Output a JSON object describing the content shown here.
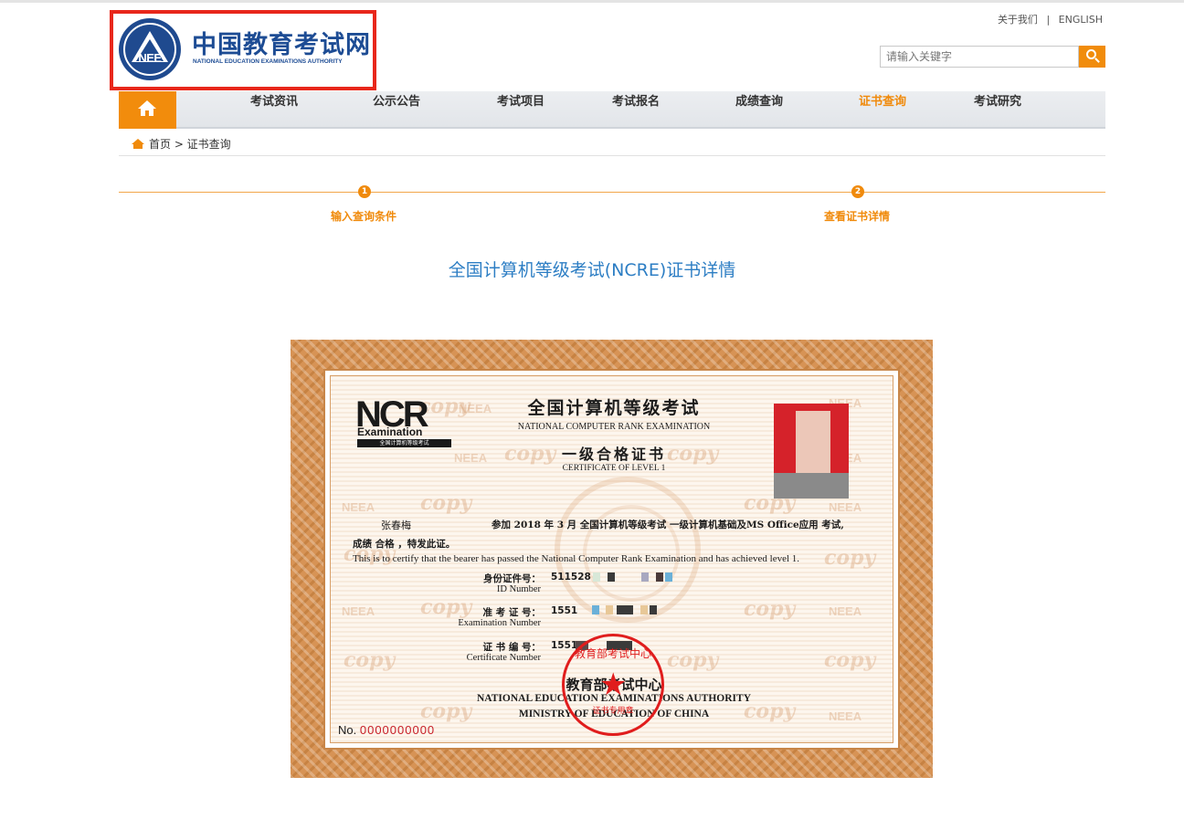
{
  "brand": {
    "emblem_text": "NEE",
    "name_cn": "中国教育考试网",
    "name_en": "NATIONAL EDUCATION EXAMINATIONS AUTHORITY"
  },
  "toplinks": {
    "about": "关于我们",
    "sep": "|",
    "english": "ENGLISH"
  },
  "search": {
    "placeholder": "请输入关键字"
  },
  "nav": [
    {
      "label": "考试资讯",
      "active": false
    },
    {
      "label": "公示公告",
      "active": false
    },
    {
      "label": "考试项目",
      "active": false
    },
    {
      "label": "考试报名",
      "active": false
    },
    {
      "label": "成绩查询",
      "active": false
    },
    {
      "label": "证书查询",
      "active": true
    },
    {
      "label": "考试研究",
      "active": false
    }
  ],
  "breadcrumb": {
    "text": "首页 > 证书查询"
  },
  "steps": [
    {
      "num": "1",
      "label": "输入查询条件"
    },
    {
      "num": "2",
      "label": "查看证书详情"
    }
  ],
  "page_title": "全国计算机等级考试(NCRE)证书详情",
  "certificate": {
    "logo_main": "NCR",
    "logo_sub": "Examination",
    "logo_bar": "全国计算机等级考试",
    "title_cn": "全国计算机等级考试",
    "title_en": "NATIONAL COMPUTER RANK EXAMINATION",
    "level_cn": "一级合格证书",
    "level_en": "CERTIFICATE OF LEVEL 1",
    "holder_name": "张春梅",
    "line1": "参加 2018 年  3  月 全国计算机等级考试 一级计算机基础及MS Office应用  考试,",
    "line2": "成绩    合格    ，特发此证。",
    "line_en": "This is to certify that the bearer has passed the National Computer Rank Examination and has achieved level 1.",
    "id_label_cn": "身份证件号：",
    "id_label_en": "ID Number",
    "id_value": "511528",
    "exam_label_cn": "准 考 证 号：",
    "exam_label_en": "Examination Number",
    "exam_value": "1551",
    "cert_label_cn": "证 书 编 号：",
    "cert_label_en": "Certificate Number",
    "cert_value": "1551",
    "issuer_cn": "教育部考试中心",
    "issuer_en1": "NATIONAL EDUCATION EXAMINATIONS AUTHORITY",
    "issuer_en2": "MINISTRY OF EDUCATION OF CHINA",
    "serial_label": "No.",
    "serial_value": "0000000000",
    "seal_arc": "教育部考试中心",
    "seal_sub": "证书专用章",
    "watermark": "copy",
    "watermark2": "NEEA"
  }
}
